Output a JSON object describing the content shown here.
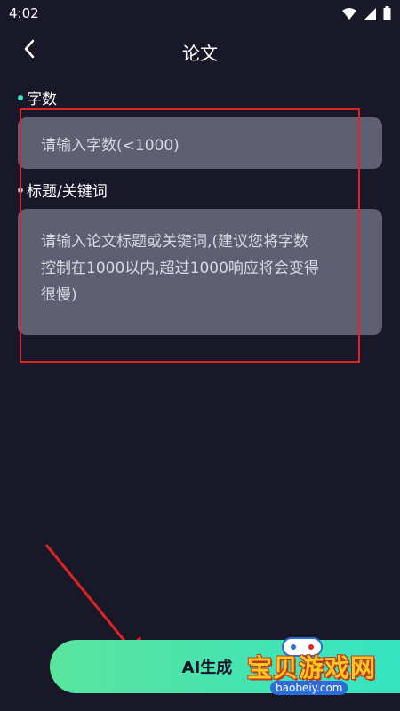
{
  "status_bar": {
    "time": "4:02",
    "icons": [
      "wifi-icon",
      "signal-icon",
      "battery-icon"
    ]
  },
  "header": {
    "title": "论文",
    "back_icon": "chevron-left-icon"
  },
  "form": {
    "word_count": {
      "label": "字数",
      "placeholder": "请输入字数(<1000)"
    },
    "title_keywords": {
      "label": "标题/关键词",
      "placeholder_lines": [
        "请输入论文标题或关键词,(建议您将字数",
        "控制在1000以内,超过1000响应将会变得",
        "很慢)"
      ]
    }
  },
  "actions": {
    "generate_label": "AI生成"
  },
  "watermark": {
    "brand": "宝贝游戏网",
    "url": "baobeiy.com"
  },
  "colors": {
    "background": "#181828",
    "input_bg": "#5e5f73",
    "accent_dot": "#3fe0d0",
    "button_gradient_start": "#5ae49d",
    "button_gradient_end": "#35e4c2",
    "annotation_red": "#e02424"
  }
}
